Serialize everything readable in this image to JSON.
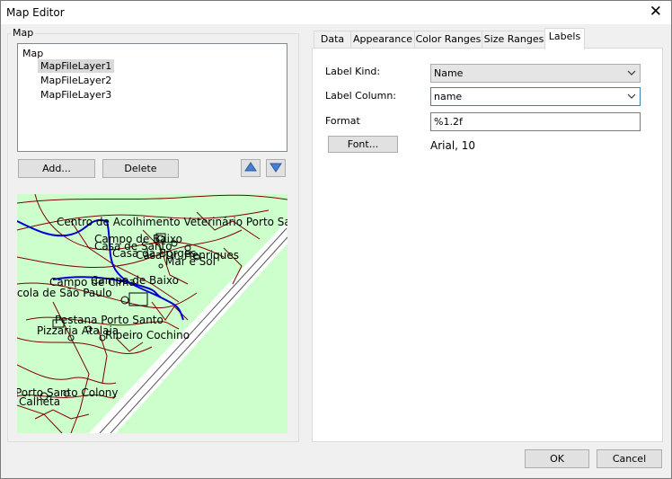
{
  "window": {
    "title": "Map Editor",
    "close_glyph": "✕"
  },
  "left": {
    "group_label": "Map",
    "tree": {
      "root": "Map",
      "items": [
        "MapFileLayer1",
        "MapFileLayer2",
        "MapFileLayer3"
      ],
      "selected_index": 0
    },
    "buttons": {
      "add": "Add...",
      "delete": "Delete"
    },
    "arrow_icons": [
      "move-up-icon",
      "move-down-icon"
    ]
  },
  "map_preview": {
    "labels": [
      "Centro de Acolhimento Veterinário Porto Santo",
      "Campo de Baixo",
      "Casa de Santo",
      "Casa da Borges",
      "Casa Dr. Henriques",
      "Mar e Sol",
      "Campo de Baixo",
      "Campo de Cima",
      "Escola de São Paulo",
      "Pestana Porto Santo",
      "Pizzaria Atalaia",
      "Ribeiro Cochino",
      "Porto Santo Colony",
      "Calheta"
    ],
    "colors": {
      "background": "#ccffcc",
      "roads": "#800000",
      "streams": "#0000cc",
      "coast": "#ffffff"
    }
  },
  "tabs": [
    {
      "label": "Data"
    },
    {
      "label": "Appearance"
    },
    {
      "label": "Color Ranges"
    },
    {
      "label": "Size Ranges"
    },
    {
      "label": "Labels",
      "active": true
    }
  ],
  "labels_tab": {
    "label_kind": {
      "label": "Label Kind:",
      "value": "Name"
    },
    "label_column": {
      "label": "Label Column:",
      "value": "name"
    },
    "format": {
      "label": "Format",
      "value": "%1.2f"
    },
    "font": {
      "button": "Font...",
      "value": "Arial, 10"
    }
  },
  "footer": {
    "ok": "OK",
    "cancel": "Cancel"
  }
}
